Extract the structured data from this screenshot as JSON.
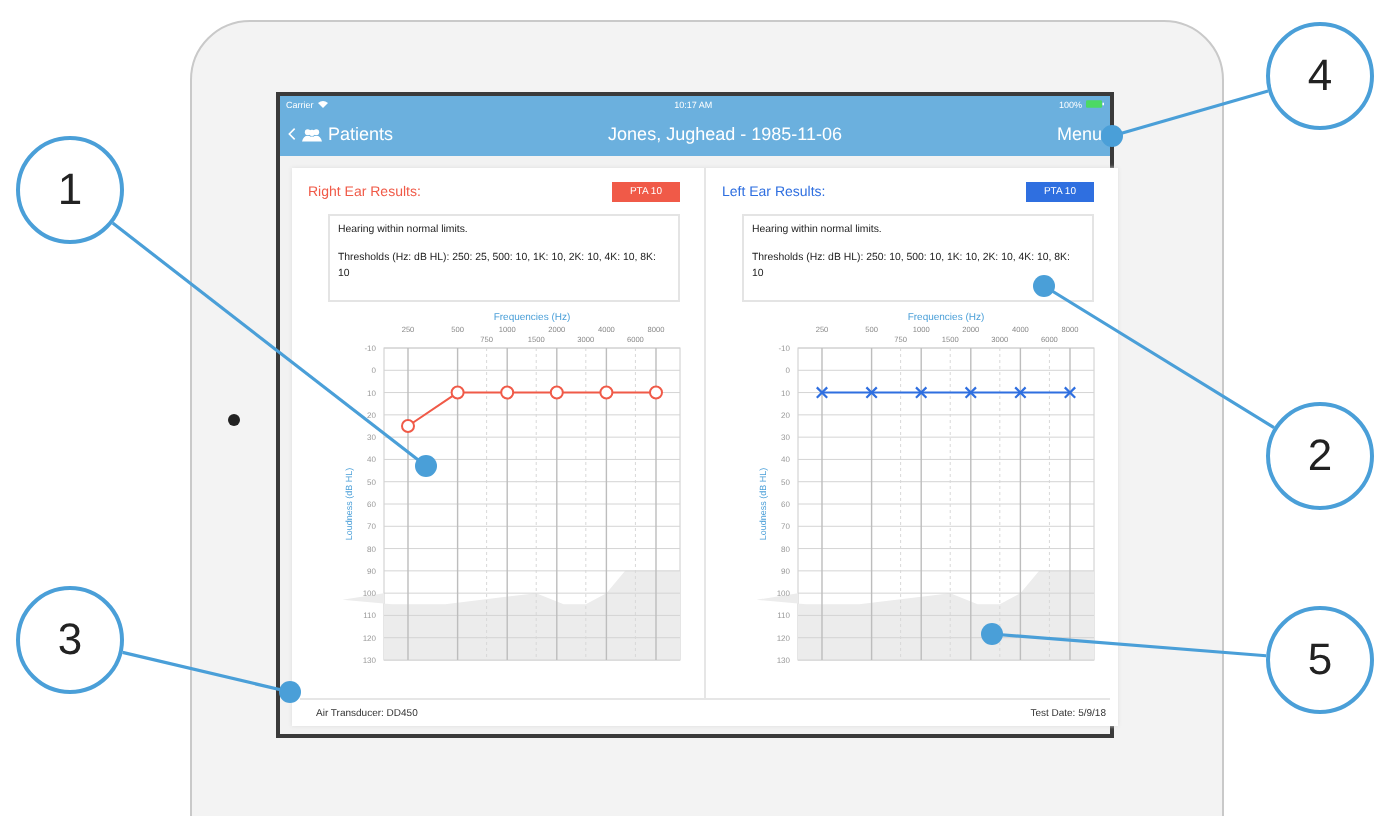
{
  "status_bar": {
    "carrier": "Carrier",
    "time": "10:17 AM",
    "battery": "100%"
  },
  "nav_bar": {
    "back": "Patients",
    "title": "Jones, Jughead - 1985-11-06",
    "menu": "Menu"
  },
  "ears": [
    {
      "title": "Right Ear Results:",
      "color": "#f05a48",
      "badge": "PTA 10",
      "summary": "Hearing within normal limits.",
      "thresholds": "Thresholds (Hz: dB HL): 250: 25, 500: 10, 1K: 10, 2K: 10, 4K: 10, 8K: 10",
      "minor_frequency_labels": [
        "750",
        "1500",
        "3000",
        "6000"
      ],
      "chart_data": {
        "type": "line",
        "xlabel": "Frequencies (Hz)",
        "ylabel": "Loudness (dB HL)",
        "categories": [
          "250",
          "500",
          "1000",
          "2000",
          "4000",
          "8000"
        ],
        "yticks": [
          -10,
          0,
          10,
          20,
          30,
          40,
          50,
          60,
          70,
          80,
          90,
          100,
          110,
          120,
          130
        ],
        "ylim": [
          130,
          -10
        ],
        "grid": true,
        "series": [
          {
            "color": "#f05a48",
            "marker": "circle",
            "values": [
              25,
              10,
              10,
              10,
              10,
              10
            ]
          }
        ]
      }
    },
    {
      "title": "Left Ear Results:",
      "color": "#2f6fe0",
      "badge": "PTA 10",
      "summary": "Hearing within normal limits.",
      "thresholds": "Thresholds (Hz: dB HL): 250: 10, 500: 10, 1K: 10, 2K: 10, 4K: 10, 8K: 10",
      "minor_frequency_labels": [
        "750",
        "1500",
        "3000",
        "6000"
      ],
      "chart_data": {
        "type": "line",
        "xlabel": "Frequencies (Hz)",
        "ylabel": "Loudness (dB HL)",
        "categories": [
          "250",
          "500",
          "1000",
          "2000",
          "4000",
          "8000"
        ],
        "yticks": [
          -10,
          0,
          10,
          20,
          30,
          40,
          50,
          60,
          70,
          80,
          90,
          100,
          110,
          120,
          130
        ],
        "ylim": [
          130,
          -10
        ],
        "grid": true,
        "series": [
          {
            "color": "#2f6fe0",
            "marker": "cross",
            "values": [
              10,
              10,
              10,
              10,
              10,
              10
            ]
          }
        ]
      }
    }
  ],
  "footer": {
    "transducer": "Air Transducer: DD450",
    "test_date": "Test Date: 5/9/18"
  },
  "callouts": [
    "4",
    "1",
    "2",
    "3",
    "5"
  ]
}
